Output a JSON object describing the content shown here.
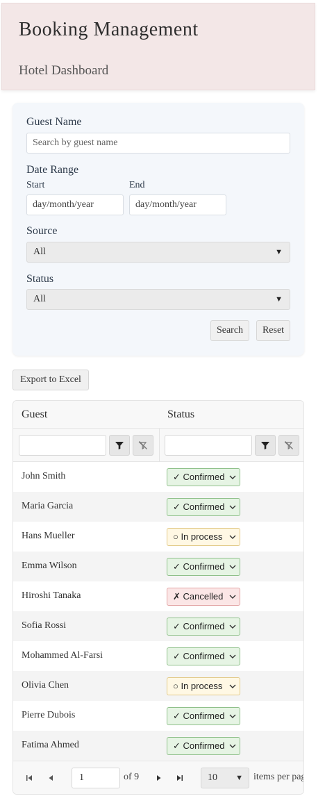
{
  "header": {
    "title": "Booking Management",
    "subtitle": "Hotel Dashboard"
  },
  "filters": {
    "guest_name_label": "Guest Name",
    "guest_name_placeholder": "Search by guest name",
    "guest_name_value": "",
    "date_range_label": "Date Range",
    "start_label": "Start",
    "end_label": "End",
    "start_value": "day/month/year",
    "end_value": "day/month/year",
    "source_label": "Source",
    "source_value": "All",
    "status_label": "Status",
    "status_value": "All",
    "search_button": "Search",
    "reset_button": "Reset"
  },
  "export_button": "Export to Excel",
  "grid": {
    "columns": [
      "Guest",
      "Status"
    ],
    "rows": [
      {
        "guest": "John Smith",
        "status": "✓ Confirmed",
        "kind": "confirmed"
      },
      {
        "guest": "Maria Garcia",
        "status": "✓ Confirmed",
        "kind": "confirmed"
      },
      {
        "guest": "Hans Mueller",
        "status": "○ In process",
        "kind": "inprocess"
      },
      {
        "guest": "Emma Wilson",
        "status": "✓ Confirmed",
        "kind": "confirmed"
      },
      {
        "guest": "Hiroshi Tanaka",
        "status": "✗ Cancelled",
        "kind": "cancelled"
      },
      {
        "guest": "Sofia Rossi",
        "status": "✓ Confirmed",
        "kind": "confirmed"
      },
      {
        "guest": "Mohammed Al-Farsi",
        "status": "✓ Confirmed",
        "kind": "confirmed"
      },
      {
        "guest": "Olivia Chen",
        "status": "○ In process",
        "kind": "inprocess"
      },
      {
        "guest": "Pierre Dubois",
        "status": "✓ Confirmed",
        "kind": "confirmed"
      },
      {
        "guest": "Fatima Ahmed",
        "status": "✓ Confirmed",
        "kind": "confirmed"
      }
    ]
  },
  "pager": {
    "page": "1",
    "of_text": "of 9",
    "page_size": "10",
    "page_size_label": "items per page"
  },
  "icons": {
    "filter": "filter-icon",
    "clear_filter": "clear-filter-icon",
    "first": "first-page-icon",
    "prev": "previous-page-icon",
    "next": "next-page-icon",
    "last": "last-page-icon",
    "dropdown": "caret-down-icon"
  }
}
